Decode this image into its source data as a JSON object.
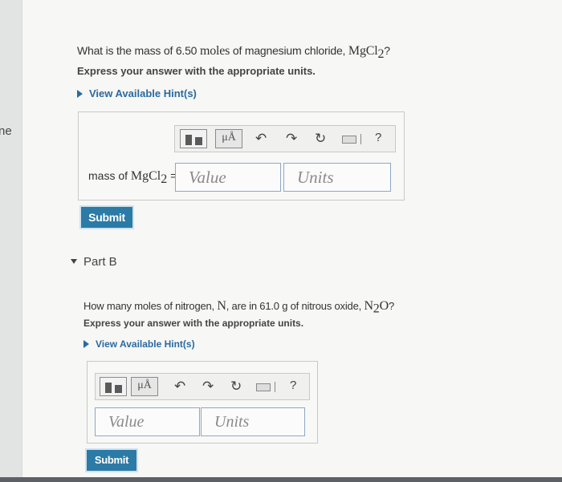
{
  "left_strip": {
    "cut_text": "ne"
  },
  "part_a": {
    "question_prefix": "What is the mass of 6.50 ",
    "question_keyword": "moles",
    "question_middle": " of magnesium chloride, ",
    "formula_main": "MgCl",
    "formula_sub": "2",
    "question_suffix": "?",
    "instruction": "Express your answer with the appropriate units.",
    "hint": "View Available Hint(s)",
    "answer_label_prefix": "mass of ",
    "answer_label_formula": "MgCl",
    "answer_label_sub": "2",
    "answer_label_suffix": " =",
    "value_placeholder": "Value",
    "units_placeholder": "Units",
    "submit_label": "Submit"
  },
  "part_b": {
    "title": "Part B",
    "question_prefix": "How many moles of nitrogen, ",
    "symbol_n": "N",
    "question_middle": ", are in 61.0 g of nitrous oxide, ",
    "formula_n": "N",
    "formula_sub": "2",
    "formula_o": "O",
    "question_suffix": "?",
    "instruction": "Express your answer with the appropriate units.",
    "hint": "View Available Hint(s)",
    "value_placeholder": "Value",
    "units_placeholder": "Units",
    "submit_label": "Submit"
  },
  "toolbar": {
    "mu_label": "μÅ",
    "undo_icon": "↶",
    "redo_icon": "↷",
    "reset_icon": "↻",
    "help_label": "?"
  }
}
